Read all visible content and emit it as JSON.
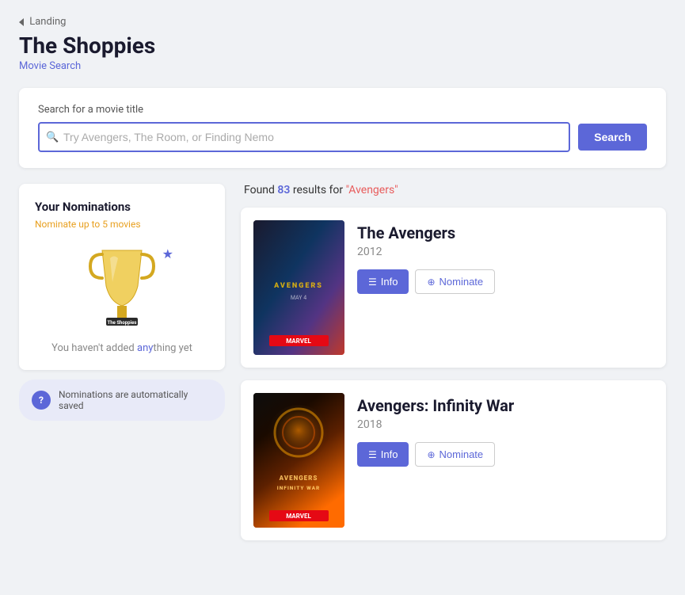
{
  "breadcrumb": {
    "parent": "Landing"
  },
  "header": {
    "title": "The Shoppies",
    "subtitle": "Movie Search"
  },
  "search": {
    "label": "Search for a movie title",
    "placeholder": "Try Avengers, The Room, or Finding Nemo",
    "button_label": "Search"
  },
  "sidebar": {
    "nominations_title": "Your Nominations",
    "nominations_subtitle": "Nominate up to 5 movies",
    "trophy_label": "The Shoppies",
    "empty_message_part1": "You haven't added ",
    "empty_message_highlight": "any",
    "empty_message_part2": "thing yet",
    "auto_save_text": "Nominations are automatically saved"
  },
  "results": {
    "count": "83",
    "query": "Avengers",
    "summary": "Found 83 results for \"Avengers\""
  },
  "movies": [
    {
      "title": "The Avengers",
      "year": "2012",
      "poster_style": "avengers",
      "poster_text": "AVENGERS"
    },
    {
      "title": "Avengers: Infinity War",
      "year": "2018",
      "poster_style": "infinity",
      "poster_text": "AVENGERS\nINFINITY WAR"
    }
  ],
  "buttons": {
    "info_label": "Info",
    "nominate_label": "Nominate"
  }
}
